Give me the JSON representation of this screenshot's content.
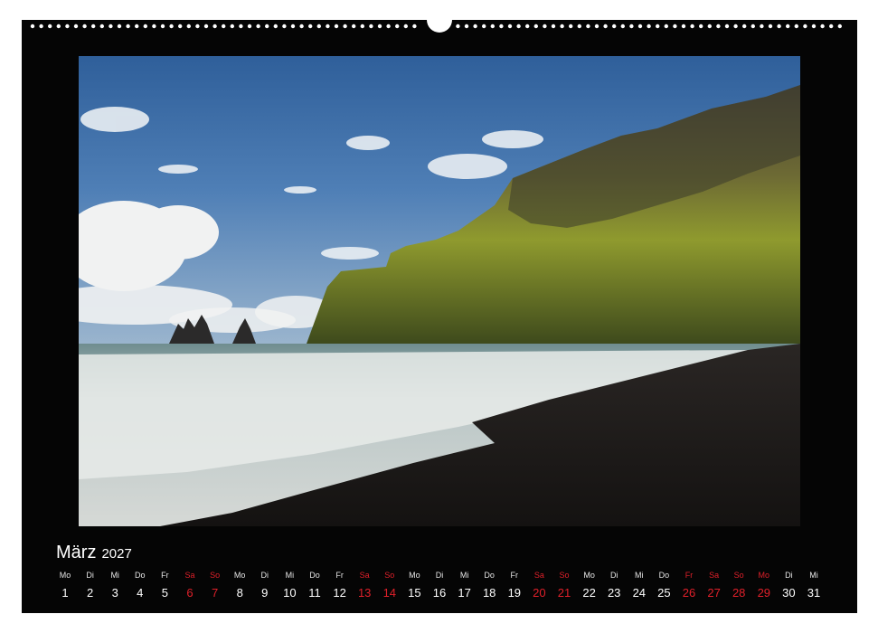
{
  "calendar": {
    "month": "März",
    "year": "2027",
    "days": [
      {
        "name": "Mo",
        "num": "1",
        "red": false
      },
      {
        "name": "Di",
        "num": "2",
        "red": false
      },
      {
        "name": "Mi",
        "num": "3",
        "red": false
      },
      {
        "name": "Do",
        "num": "4",
        "red": false
      },
      {
        "name": "Fr",
        "num": "5",
        "red": false
      },
      {
        "name": "Sa",
        "num": "6",
        "red": true
      },
      {
        "name": "So",
        "num": "7",
        "red": true
      },
      {
        "name": "Mo",
        "num": "8",
        "red": false
      },
      {
        "name": "Di",
        "num": "9",
        "red": false
      },
      {
        "name": "Mi",
        "num": "10",
        "red": false
      },
      {
        "name": "Do",
        "num": "11",
        "red": false
      },
      {
        "name": "Fr",
        "num": "12",
        "red": false
      },
      {
        "name": "Sa",
        "num": "13",
        "red": true
      },
      {
        "name": "So",
        "num": "14",
        "red": true
      },
      {
        "name": "Mo",
        "num": "15",
        "red": false
      },
      {
        "name": "Di",
        "num": "16",
        "red": false
      },
      {
        "name": "Mi",
        "num": "17",
        "red": false
      },
      {
        "name": "Do",
        "num": "18",
        "red": false
      },
      {
        "name": "Fr",
        "num": "19",
        "red": false
      },
      {
        "name": "Sa",
        "num": "20",
        "red": true
      },
      {
        "name": "So",
        "num": "21",
        "red": true
      },
      {
        "name": "Mo",
        "num": "22",
        "red": false
      },
      {
        "name": "Di",
        "num": "23",
        "red": false
      },
      {
        "name": "Mi",
        "num": "24",
        "red": false
      },
      {
        "name": "Do",
        "num": "25",
        "red": false
      },
      {
        "name": "Fr",
        "num": "26",
        "red": true
      },
      {
        "name": "Sa",
        "num": "27",
        "red": true
      },
      {
        "name": "So",
        "num": "28",
        "red": true
      },
      {
        "name": "Mo",
        "num": "29",
        "red": true
      },
      {
        "name": "Di",
        "num": "30",
        "red": false
      },
      {
        "name": "Mi",
        "num": "31",
        "red": false
      }
    ]
  },
  "colors": {
    "page_background": "#050505",
    "weekday_text": "#ffffff",
    "holiday_text": "#e0202a"
  }
}
